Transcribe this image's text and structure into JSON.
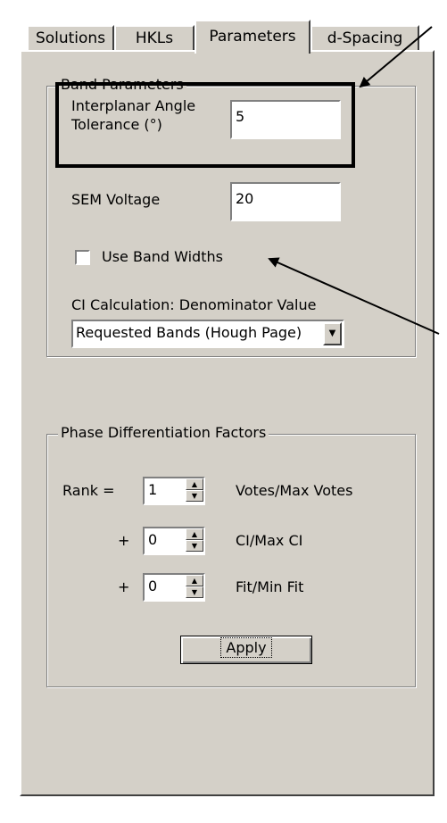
{
  "tabs": [
    {
      "label": "Solutions"
    },
    {
      "label": "HKLs"
    },
    {
      "label": "Parameters"
    },
    {
      "label": "d-Spacing"
    }
  ],
  "band_parameters": {
    "title": "Band Parameters",
    "angle_label_line1": "Interplanar Angle",
    "angle_label_line2": "Tolerance (°)",
    "angle_value": "5",
    "voltage_label": "SEM Voltage",
    "voltage_value": "20",
    "use_band_widths_label": "Use Band Widths",
    "use_band_widths_checked": false,
    "ci_label": "CI Calculation: Denominator Value",
    "ci_selected": "Requested Bands (Hough Page)"
  },
  "phase_differentiation": {
    "title": "Phase Differentiation Factors",
    "rank_label": "Rank =",
    "rows": [
      {
        "prefix": "",
        "value": "1",
        "label": "Votes/Max Votes"
      },
      {
        "prefix": "+",
        "value": "0",
        "label": "CI/Max CI"
      },
      {
        "prefix": "+",
        "value": "0",
        "label": "Fit/Min Fit"
      }
    ],
    "apply_label": "Apply"
  },
  "colors": {
    "face": "#d4d0c8",
    "shadow": "#808080",
    "highlight": "#ffffff"
  }
}
